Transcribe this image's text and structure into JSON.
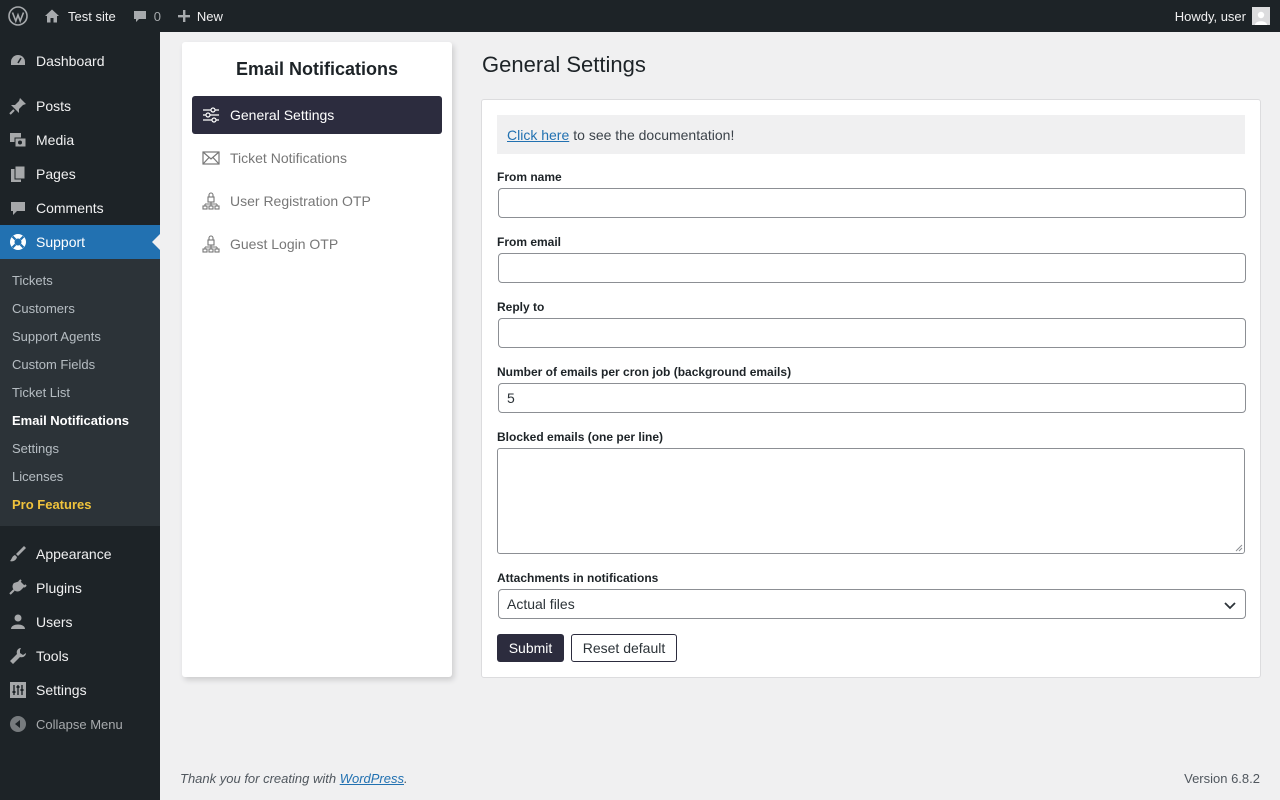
{
  "adminbar": {
    "site_name": "Test site",
    "comments_count": "0",
    "new_label": "New",
    "greeting": "Howdy, user"
  },
  "sidebar": {
    "top_items": [
      {
        "label": "Dashboard",
        "icon": "dashboard-icon"
      },
      {
        "label": "Posts",
        "icon": "pin-icon"
      },
      {
        "label": "Media",
        "icon": "media-icon"
      },
      {
        "label": "Pages",
        "icon": "pages-icon"
      },
      {
        "label": "Comments",
        "icon": "comment-icon"
      },
      {
        "label": "Support",
        "icon": "lifebuoy-icon"
      }
    ],
    "submenu": [
      {
        "label": "Tickets"
      },
      {
        "label": "Customers"
      },
      {
        "label": "Support Agents"
      },
      {
        "label": "Custom Fields"
      },
      {
        "label": "Ticket List"
      },
      {
        "label": "Email Notifications"
      },
      {
        "label": "Settings"
      },
      {
        "label": "Licenses"
      },
      {
        "label": "Pro Features"
      }
    ],
    "bottom_items": [
      {
        "label": "Appearance",
        "icon": "brush-icon"
      },
      {
        "label": "Plugins",
        "icon": "plug-icon"
      },
      {
        "label": "Users",
        "icon": "user-icon"
      },
      {
        "label": "Tools",
        "icon": "wrench-icon"
      },
      {
        "label": "Settings",
        "icon": "settings-icon"
      }
    ],
    "collapse_label": "Collapse Menu"
  },
  "left_panel": {
    "title": "Email Notifications",
    "items": [
      {
        "label": "General Settings",
        "icon": "sliders-icon"
      },
      {
        "label": "Ticket Notifications",
        "icon": "envelope-icon"
      },
      {
        "label": "User Registration OTP",
        "icon": "lock-network-icon"
      },
      {
        "label": "Guest Login OTP",
        "icon": "lock-network-icon"
      }
    ]
  },
  "main": {
    "title": "General Settings",
    "doc_link": "Click here",
    "doc_text": "to see the documentation!",
    "fields": {
      "from_name": {
        "label": "From name",
        "value": ""
      },
      "from_email": {
        "label": "From email",
        "value": ""
      },
      "reply_to": {
        "label": "Reply to",
        "value": ""
      },
      "cron": {
        "label": "Number of emails per cron job (background emails)",
        "value": "5"
      },
      "blocked": {
        "label": "Blocked emails (one per line)",
        "value": ""
      },
      "attachments": {
        "label": "Attachments in notifications",
        "value": "Actual files"
      }
    },
    "submit_label": "Submit",
    "reset_label": "Reset default"
  },
  "footer": {
    "thanks_prefix": "Thank you for creating with",
    "wordpress_link": "WordPress",
    "thanks_suffix": ".",
    "version": "Version 6.8.2"
  },
  "colors": {
    "admin_dark": "#1d2327",
    "accent_blue": "#2271b1",
    "nav_active": "#2c2c3e",
    "pro_yellow": "#f0c33c"
  }
}
